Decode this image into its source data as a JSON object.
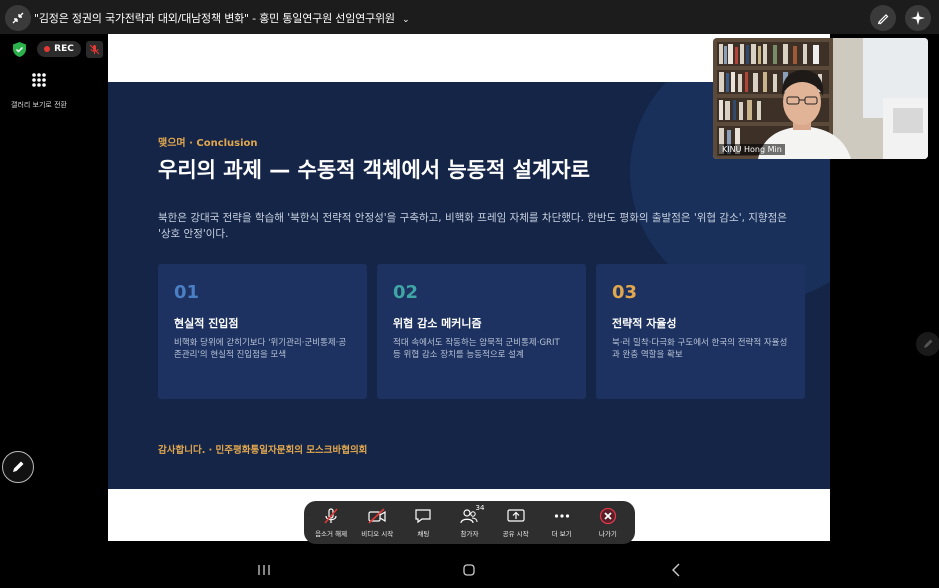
{
  "window": {
    "title": "\"김정은 정권의 국가전략과 대외/대남정책 변화\" - 홍민 통일연구원 선임연구위원",
    "dropdown_icon": "chevron-down-icon"
  },
  "status": {
    "rec_label": "REC",
    "gallery_label": "갤러리 보기로 전환"
  },
  "slide": {
    "eyebrow": "맺으며 · Conclusion",
    "heading": "우리의 과제 — 수동적 객체에서 능동적 설계자로",
    "description": "북한은 강대국 전략을 학습해 '북한식 전략적 안정성'을 구축하고, 비핵화 프레임 자체를 차단했다. 한반도 평화의 출발점은 '위협 감소', 지향점은 '상호 안정'이다.",
    "cards": [
      {
        "num": "01",
        "title": "현실적 진입점",
        "desc": "비핵화 당위에 갇히기보다 '위기관리·군비통제·공존관리'의 현실적 진입점을 모색",
        "num_color": "#4a7fc4"
      },
      {
        "num": "02",
        "title": "위협 감소 메커니즘",
        "desc": "적대 속에서도 작동하는 암묵적 군비통제·GRIT 등 위협 감소 장치를 능동적으로 설계",
        "num_color": "#3fa6a6"
      },
      {
        "num": "03",
        "title": "전략적 자율성",
        "desc": "북·러 밀착·다극화 구도에서 한국의 전략적 자율성과 완충 역할을 확보",
        "num_color": "#e2a74e"
      }
    ],
    "thanks": "감사합니다. · 민주평화통일자문회의 모스크바협의회"
  },
  "video": {
    "participant_name": "KINU Hong Min"
  },
  "toolbar": {
    "unmute": "음소거 해제",
    "start_video": "비디오 시작",
    "chat": "채팅",
    "participants": "참가자",
    "participants_count": "34",
    "share": "공유 시작",
    "more": "더 보기",
    "leave": "나가기"
  },
  "colors": {
    "slide_bg": "#142547",
    "accent": "#e2a74e",
    "toolbar_bg": "#2e2e2e"
  }
}
